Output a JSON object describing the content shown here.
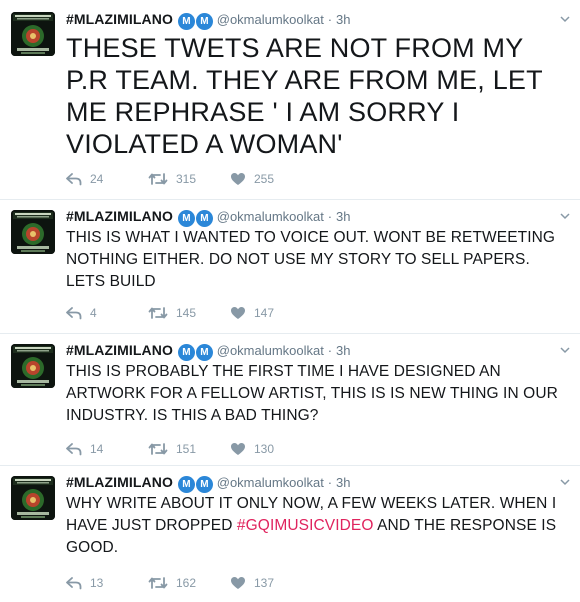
{
  "tweets": [
    {
      "name": "#MLAZIMILANO",
      "badges": [
        "M",
        "M"
      ],
      "handle": "@okmalumkoolkat",
      "dot": "·",
      "time": "3h",
      "text_parts": [
        "THESE TWETS ARE NOT FROM MY P.R TEAM. THEY ARE FROM ME, LET ME REPHRASE ' I AM SORRY I VIOLATED A WOMAN'"
      ],
      "replies": "24",
      "retweets": "315",
      "likes": "255"
    },
    {
      "name": "#MLAZIMILANO",
      "badges": [
        "M",
        "M"
      ],
      "handle": "@okmalumkoolkat",
      "dot": "·",
      "time": "3h",
      "text_parts": [
        "THIS IS WHAT I WANTED TO VOICE OUT. WONT BE RETWEETING NOTHING EITHER. DO NOT USE MY STORY TO SELL PAPERS. LETS BUILD"
      ],
      "replies": "4",
      "retweets": "145",
      "likes": "147"
    },
    {
      "name": "#MLAZIMILANO",
      "badges": [
        "M",
        "M"
      ],
      "handle": "@okmalumkoolkat",
      "dot": "·",
      "time": "3h",
      "text_parts": [
        "THIS IS PROBABLY THE FIRST TIME I HAVE DESIGNED AN ARTWORK FOR A FELLOW ARTIST, THIS IS IS NEW THING IN OUR INDUSTRY. IS THIS A BAD THING?"
      ],
      "replies": "14",
      "retweets": "151",
      "likes": "130"
    },
    {
      "name": "#MLAZIMILANO",
      "badges": [
        "M",
        "M"
      ],
      "handle": "@okmalumkoolkat",
      "dot": "·",
      "time": "3h",
      "text_parts": [
        "WHY WRITE ABOUT IT ONLY NOW, A FEW WEEKS LATER. WHEN I HAVE JUST DROPPED ",
        "#GQIMUSICVIDEO",
        " AND THE RESPONSE IS GOOD."
      ],
      "replies": "13",
      "retweets": "162",
      "likes": "137"
    }
  ],
  "colors": {
    "hashtag": "#e0245e",
    "meta": "#657786",
    "icon": "#8899a6",
    "badge": "#2b87d8"
  },
  "icons": {
    "reply": "reply-icon",
    "retweet": "retweet-icon",
    "like": "heart-icon",
    "menu": "chevron-down-icon",
    "badge": "verified-m-icon"
  }
}
